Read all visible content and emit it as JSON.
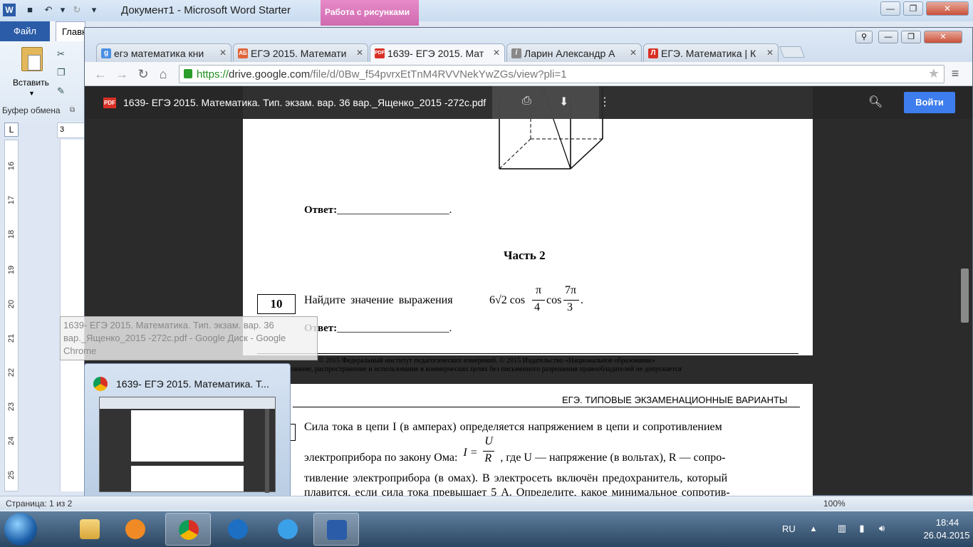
{
  "word": {
    "title": "Документ1  -  Microsoft Word Starter",
    "context_tab": "Работа с рисунками",
    "file_tab": "Файл",
    "home_tab": "Главн",
    "paste_label": "Вставить",
    "clipboard_label": "Буфер обмена",
    "ruler_numbers": [
      "16",
      "17",
      "18",
      "19",
      "20",
      "21",
      "22",
      "23",
      "24",
      "25"
    ],
    "ruler_top": "3",
    "status_page": "Страница: 1 из 2"
  },
  "chrome": {
    "tabs": [
      {
        "label": "егэ математика кни",
        "icon_color": "#4a90e2",
        "icon_text": "g"
      },
      {
        "label": "ЕГЭ 2015. Математи",
        "icon_color": "#e2643a",
        "icon_text": "АБ"
      },
      {
        "label": "1639- ЕГЭ 2015. Мат",
        "icon_color": "#d93025",
        "icon_text": "PDF"
      },
      {
        "label": "Ларин Александр А",
        "icon_color": "#888888",
        "icon_text": "/"
      },
      {
        "label": "ЕГЭ. Математика | К",
        "icon_color": "#d93025",
        "icon_text": "Л"
      }
    ],
    "url_scheme": "https://",
    "url_host": "drive.google.com",
    "url_path": "/file/d/0Bw_f54pvrxEtTnM4RVVNekYwZGs/view?pli=1",
    "doc_title": "1639- ЕГЭ 2015. Математика. Тип. экзам. вар. 36 вар._Ященко_2015 -272c.pdf",
    "signin": "Войти"
  },
  "pdf": {
    "answer_label": "Ответ:",
    "answer_blank": "_____________________.",
    "part_heading": "Часть 2",
    "task_number": "10",
    "task_text": "Найдите значение выражения",
    "footer_line1": "© 2015 Федеральный институт педагогических измерений. © 2015 Издательство «Национальное образование»",
    "footer_line2": "Копирование, распространение и использование в коммерческих целях без письменного разрешения правообладателей не допускается",
    "page2_header": "ЕГЭ. ТИПОВЫЕ ЭКЗАМЕНАЦИОННЫЕ ВАРИАНТЫ",
    "page2_line1": "Сила тока в цепи I (в амперах) определяется напряжением в цепи и сопротивлением",
    "page2_line2a": "электроприбора по закону Ома:",
    "page2_line2b": ", где U — напряжение (в вольтах), R — сопро-",
    "page2_line3": "тивление электроприбора (в омах). В электросеть включён предохранитель, который",
    "page2_line4": "плавится, если сила тока превышает 5 А. Определите, какое минимальное сопротив-"
  },
  "tooltip": "1639- ЕГЭ 2015. Математика. Тип. экзам. вар. 36 вар._Ященко_2015 -272c.pdf - Google Диск - Google Chrome",
  "preview_title": "1639- ЕГЭ 2015. Математика. Т...",
  "taskbar": {
    "lang": "RU",
    "time": "18:44",
    "date": "26.04.2015",
    "zoom": "100%"
  }
}
